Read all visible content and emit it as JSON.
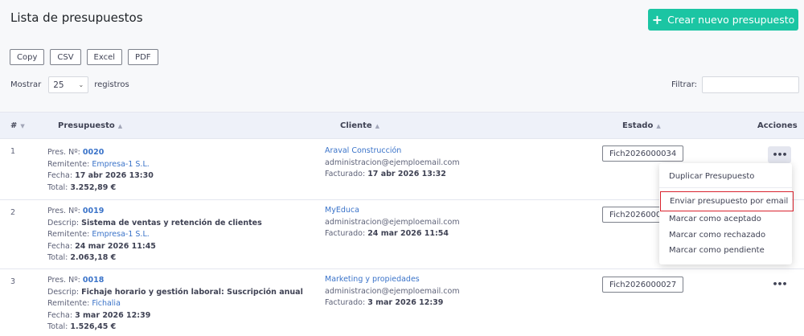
{
  "header": {
    "title": "Lista de presupuestos",
    "create_button": "Crear nuevo presupuesto"
  },
  "export_buttons": [
    "Copy",
    "CSV",
    "Excel",
    "PDF"
  ],
  "length": {
    "label_before": "Mostrar",
    "value": "25",
    "label_after": "registros"
  },
  "filter": {
    "label": "Filtrar:",
    "value": ""
  },
  "table": {
    "columns": {
      "num": "#",
      "presupuesto": "Presupuesto",
      "cliente": "Cliente",
      "estado": "Estado",
      "acciones": "Acciones"
    },
    "labels": {
      "pres_no": "Pres. Nº:",
      "descrip": "Descrip:",
      "remitente": "Remitente:",
      "fecha": "Fecha:",
      "total": "Total:",
      "facturado": "Facturado:"
    },
    "rows": [
      {
        "num": "1",
        "pres_no": "0020",
        "remitente": "Empresa-1 S.L.",
        "fecha": "17 abr 2026 13:30",
        "total": "3.252,89 €",
        "cliente": "Araval Construcción",
        "email": "administracion@ejemploemail.com",
        "facturado": "17 abr 2026 13:32",
        "estado": "Fich2026000034"
      },
      {
        "num": "2",
        "pres_no": "0019",
        "descrip": "Sistema de ventas y retención de clientes",
        "remitente": "Empresa-1 S.L.",
        "fecha": "24 mar 2026 11:45",
        "total": "2.063,18 €",
        "cliente": "MyEduca",
        "email": "administracion@ejemploemail.com",
        "facturado": "24 mar 2026 11:54",
        "estado": "Fich2026000033"
      },
      {
        "num": "3",
        "pres_no": "0018",
        "descrip": "Fichaje horario y gestión laboral: Suscripción anual",
        "remitente": "Fichalia",
        "fecha": "3 mar 2026 12:39",
        "total": "1.526,45 €",
        "cliente": "Marketing y propiedades",
        "email": "administracion@ejemploemail.com",
        "facturado": "3 mar 2026 12:39",
        "estado": "Fich2026000027"
      }
    ]
  },
  "dropdown_menu": {
    "items": [
      "Duplicar Presupuesto",
      "Enviar presupuesto por email",
      "Marcar como aceptado",
      "Marcar como rechazado",
      "Marcar como pendiente"
    ]
  },
  "colors": {
    "accent_green": "#1bc5a3",
    "link_blue": "#3a73c9",
    "highlight_red": "#d9232e",
    "header_bg": "#eef1f9"
  }
}
